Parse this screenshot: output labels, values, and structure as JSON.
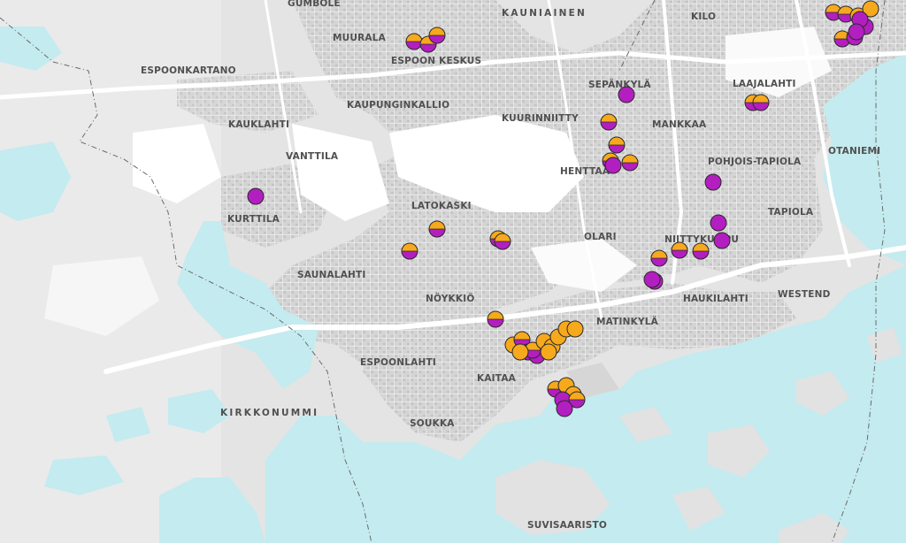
{
  "colors": {
    "water": "#c4ebef",
    "land": "#e3e3e3",
    "land_light": "#f2f2f2",
    "urban": "#d2d2d2",
    "open_area": "#ffffff",
    "road": "#ffffff",
    "boundary": "#6a6a6a",
    "label": "#505050",
    "marker_purple": "#b31ec0",
    "marker_orange": "#f6a91c",
    "marker_outline": "#2a2a2a"
  },
  "labels": {
    "gumbole": "GUMBOLE",
    "kauniainen": "KAUNIAINEN",
    "kilo": "KILO",
    "muurala": "MUURALA",
    "espoon_keskus": "ESPOON KESKUS",
    "espoonkartano": "ESPOONKARTANO",
    "sepankyla": "SEPÄNKYLÄ",
    "laajalahti": "LAAJALAHTI",
    "kaupunginkallio": "KAUPUNGINKALLIO",
    "kuurinniitty": "KUURINNIITTY",
    "kauklahti": "KAUKLAHTI",
    "mankkaa": "MANKKAA",
    "otaniemi": "OTANIEMI",
    "vanttila": "VANTTILA",
    "henttaa": "HENTTAA",
    "pohjois_tapiola": "POHJOIS-TAPIOLA",
    "kurttila": "KURTTILA",
    "latokaski": "LATOKASKI",
    "tapiola": "TAPIOLA",
    "olari": "OLARI",
    "niittykumpu": "NIITTYKUMPU",
    "saunalahti": "SAUNALAHTI",
    "westend": "WESTEND",
    "noykkio": "NÖYKKIÖ",
    "haukilahti": "HAUKILAHTI",
    "matinkyla": "MATINKYLÄ",
    "espoonlahti": "ESPOONLAHTI",
    "kaitaa": "KAITAA",
    "kirkkonummi": "KIRKKONUMMI",
    "soukka": "SOUKKA",
    "suvisaaristo": "SUVISAARISTO"
  },
  "marker_types": [
    "purple",
    "orange-purple",
    "orange"
  ]
}
